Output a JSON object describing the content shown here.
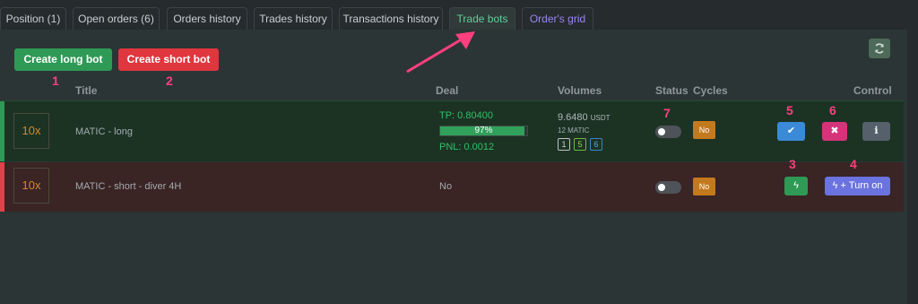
{
  "tabs": [
    {
      "label": "Position (1)"
    },
    {
      "label": "Open orders (6)"
    },
    {
      "label": "Orders history"
    },
    {
      "label": "Trades history"
    },
    {
      "label": "Transactions history"
    },
    {
      "label": "Trade bots"
    },
    {
      "label": "Order's grid"
    }
  ],
  "actions": {
    "create_long": "Create long bot",
    "create_short": "Create short bot"
  },
  "columns": {
    "title": "Title",
    "deal": "Deal",
    "volumes": "Volumes",
    "status": "Status",
    "cycles": "Cycles",
    "control": "Control"
  },
  "bots": [
    {
      "leverage": "10x",
      "title": "MATIC - long",
      "tp": "TP: 0.80400",
      "progress_label": "97%",
      "progress_fraction": 0.97,
      "pnl": "PNL: 0.0012",
      "volume_value": "9.6480",
      "volume_unit": "USDT",
      "volume_matic": "12 MATIC",
      "counts": [
        "1",
        "5",
        "6"
      ],
      "cycles": "No"
    },
    {
      "leverage": "10x",
      "title": "MATIC - short - diver 4H",
      "deal": "No",
      "cycles": "No",
      "turn_on_label": "+ Turn on"
    }
  ],
  "annotations": [
    "1",
    "2",
    "3",
    "4",
    "5",
    "6",
    "7"
  ],
  "colors": {
    "accent_green": "#2e9a55",
    "accent_red": "#e0363e",
    "arrow": "#ff3f7e"
  }
}
